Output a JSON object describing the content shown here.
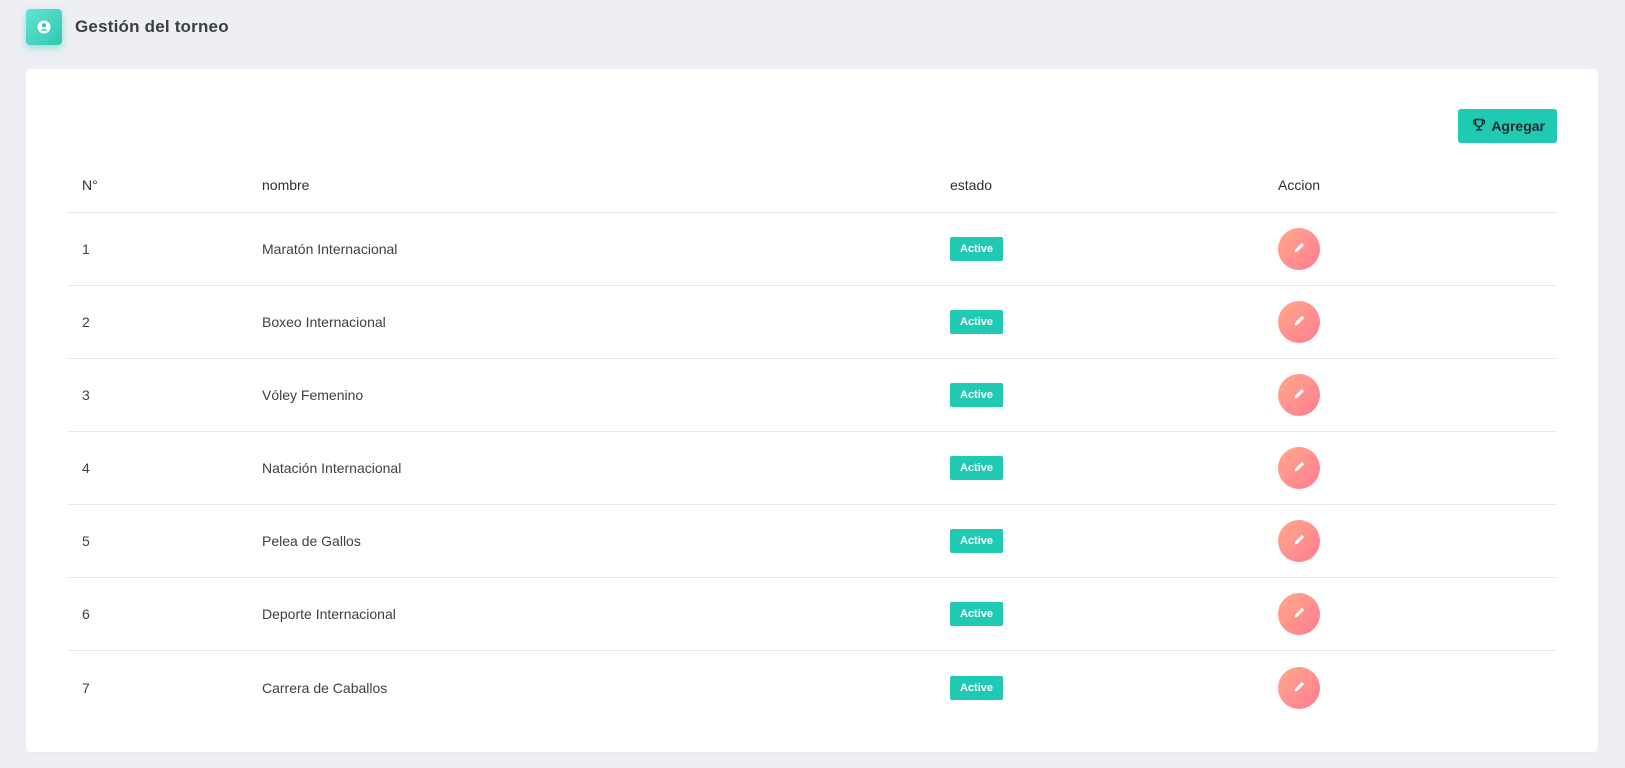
{
  "header": {
    "title": "Gestión del torneo",
    "icon": "user-circle-icon",
    "icon_color": "#2cc8b1"
  },
  "toolbar": {
    "add_label": "Agregar",
    "add_icon": "trophy-icon",
    "accent": "#20c9b1"
  },
  "table": {
    "columns": [
      "N°",
      "nombre",
      "estado",
      "Accion"
    ],
    "rows": [
      {
        "num": "1",
        "name": "Maratón Internacional",
        "status": "Active"
      },
      {
        "num": "2",
        "name": "Boxeo Internacional",
        "status": "Active"
      },
      {
        "num": "3",
        "name": "Vóley Femenino",
        "status": "Active"
      },
      {
        "num": "4",
        "name": "Natación Internacional",
        "status": "Active"
      },
      {
        "num": "5",
        "name": "Pelea de Gallos",
        "status": "Active"
      },
      {
        "num": "6",
        "name": "Deporte Internacional",
        "status": "Active"
      },
      {
        "num": "7",
        "name": "Carrera de Caballos",
        "status": "Active"
      }
    ],
    "action_icon": "pencil-icon",
    "action_color": "#ff8c8c"
  }
}
